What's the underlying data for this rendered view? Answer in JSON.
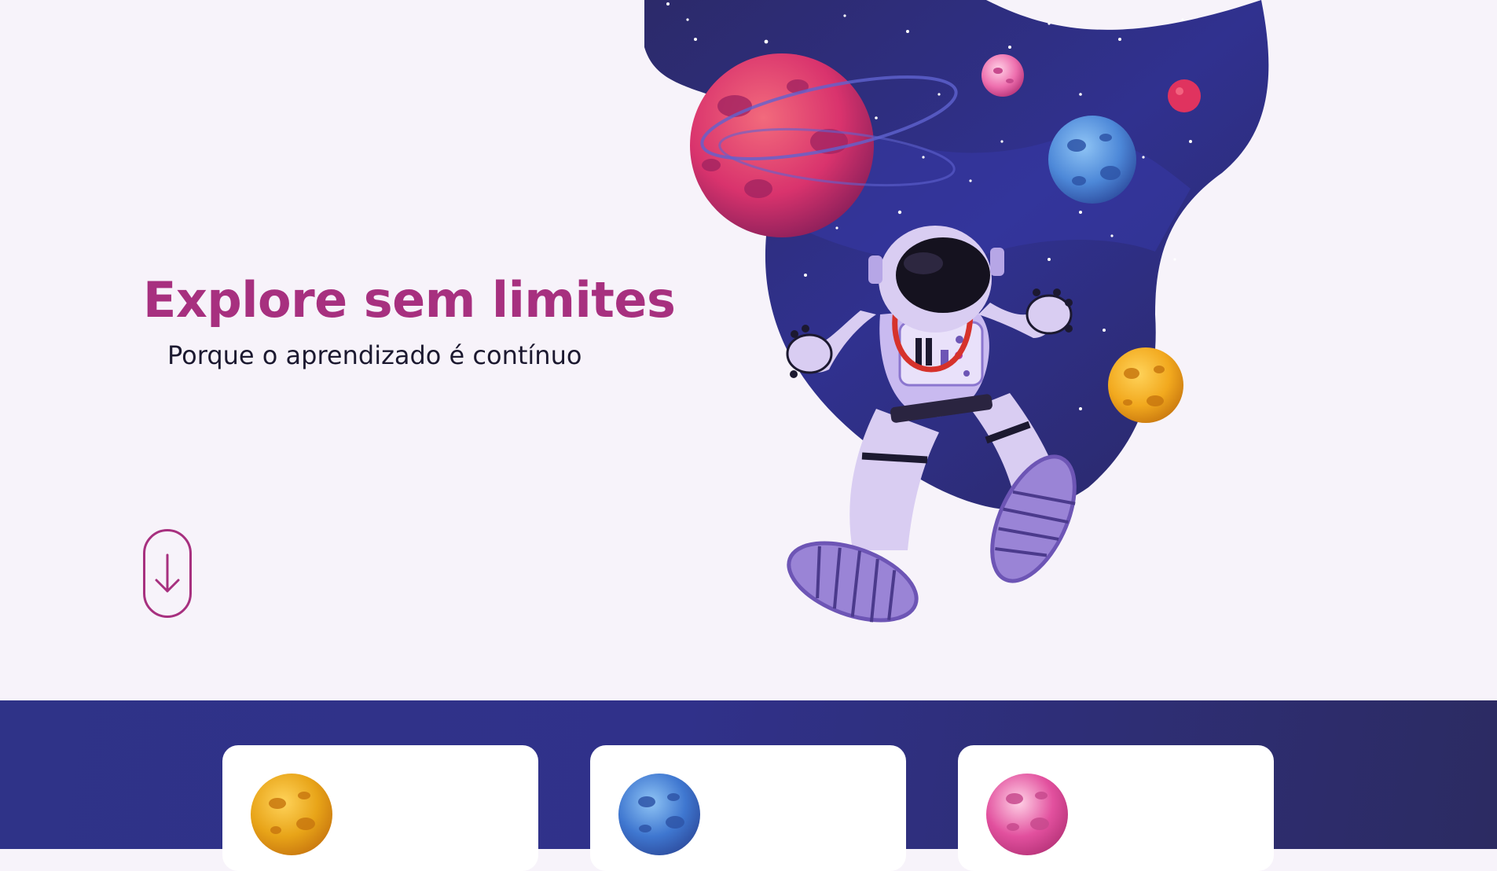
{
  "hero": {
    "title": "Explore sem limites",
    "subtitle": "Porque o aprendizado é contínuo",
    "scroll_icon": "arrow-down-icon",
    "illustration": "astronaut-in-space-illustration"
  },
  "cards": [
    {
      "icon": "yellow-planet-icon",
      "color": "#e8a418"
    },
    {
      "icon": "blue-planet-icon",
      "color": "#3f77d0"
    },
    {
      "icon": "pink-planet-icon",
      "color": "#e2509e"
    }
  ],
  "colors": {
    "accent": "#a7307f",
    "background": "#f7f3fa",
    "band_start": "#2f3388",
    "band_end": "#2c2b62",
    "text": "#1c1930"
  }
}
